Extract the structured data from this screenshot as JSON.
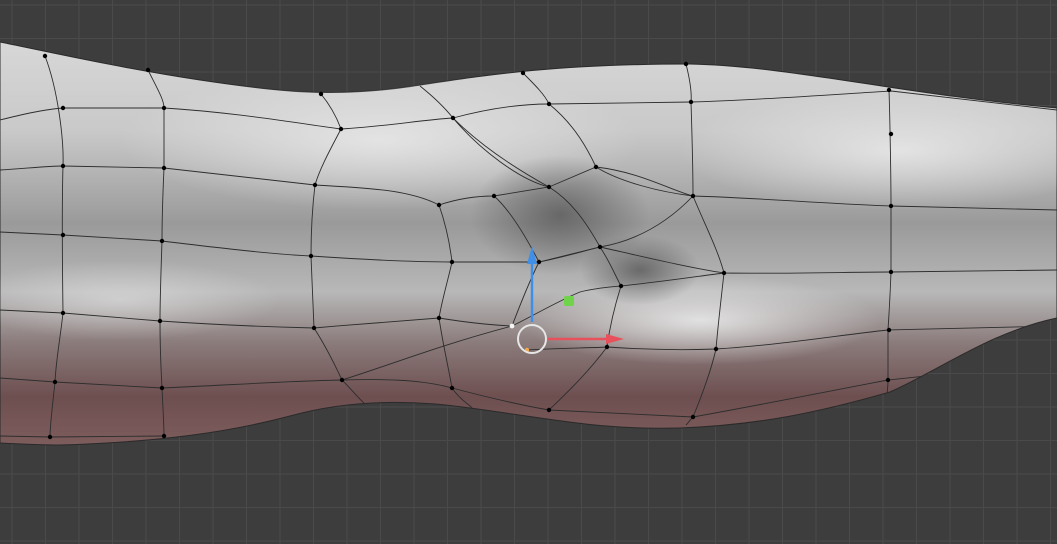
{
  "viewport": {
    "background_color": "#3d3d3d",
    "grid_color": "#4a4a4a",
    "grid_visible": true
  },
  "mesh": {
    "shading": "solid",
    "base_color": "#bdbdbd",
    "highlight_color": "#dedede",
    "shadow_color": "#6a6a6a",
    "lower_tint_color": "#7a5354",
    "wire_color": "#2d2d2d",
    "vertex_color": "#000000",
    "selected_vertex_color": "#f5f5f5"
  },
  "gizmo": {
    "type": "move-gizmo",
    "x_axis_color": "#e8505b",
    "y_axis_color": "#6fd44a",
    "z_axis_color": "#3f8fe8",
    "center_ring_color": "#e6e6e6"
  },
  "icons": [
    "move-gizmo-icon",
    "arrow-x-icon",
    "arrow-z-icon",
    "plane-handle-icon",
    "center-ring-icon"
  ]
}
